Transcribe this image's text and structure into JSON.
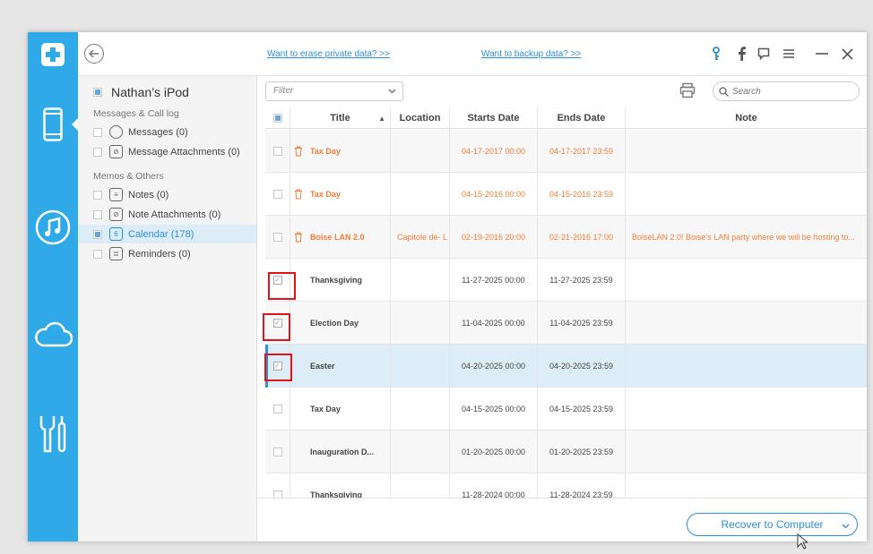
{
  "topbar": {
    "erase_link": "Want to erase private data? >>",
    "backup_link": "Want to backup data? >>"
  },
  "sidebar": {
    "device_name": "Nathan’s iPod",
    "group_messages": "Messages & Call log",
    "group_memos": "Memos & Others",
    "items": [
      {
        "label": "Messages (0)"
      },
      {
        "label": "Message Attachments (0)"
      },
      {
        "label": "Notes (0)"
      },
      {
        "label": "Note Attachments (0)"
      },
      {
        "label": "Calendar (178)"
      },
      {
        "label": "Reminders (0)"
      }
    ]
  },
  "toolbar": {
    "filter_placeholder": "Filter",
    "search_placeholder": "Search"
  },
  "table": {
    "columns": [
      "Title",
      "Location",
      "Starts Date",
      "Ends Date",
      "Note"
    ],
    "rows": [
      {
        "title": "Tax Day",
        "location": "",
        "start": "04-17-2017 00:00",
        "end": "04-17-2017 23:59",
        "note": ""
      },
      {
        "title": "Tax Day",
        "location": "",
        "start": "04-15-2016 00:00",
        "end": "04-15-2016 23:59",
        "note": ""
      },
      {
        "title": "Boise LAN 2.0",
        "location": "Capitole de- L",
        "start": "02-19-2016 20:00",
        "end": "02-21-2016 17:00",
        "note": "BoiseLAN 2.0! Boise's LAN party where we will be hosting to..."
      },
      {
        "title": "Thanksgiving",
        "location": "",
        "start": "11-27-2025 00:00",
        "end": "11-27-2025 23:59",
        "note": ""
      },
      {
        "title": "Election Day",
        "location": "",
        "start": "11-04-2025 00:00",
        "end": "11-04-2025 23:59",
        "note": ""
      },
      {
        "title": "Easter",
        "location": "",
        "start": "04-20-2025 00:00",
        "end": "04-20-2025 23:59",
        "note": ""
      },
      {
        "title": "Tax Day",
        "location": "",
        "start": "04-15-2025 00:00",
        "end": "04-15-2025 23:59",
        "note": ""
      },
      {
        "title": "Inauguration D...",
        "location": "",
        "start": "01-20-2025 00:00",
        "end": "01-20-2025 23:59",
        "note": ""
      },
      {
        "title": "Thanksgiving",
        "location": "",
        "start": "11-28-2024 00:00",
        "end": "11-28-2024 23:59",
        "note": ""
      }
    ]
  },
  "bottom": {
    "recover_label": "Recover to Computer"
  },
  "colors": {
    "accent": "#2fa9e8",
    "link": "#2b90d9",
    "deleted": "#f07e3a",
    "highlight_box": "#e0131b"
  }
}
